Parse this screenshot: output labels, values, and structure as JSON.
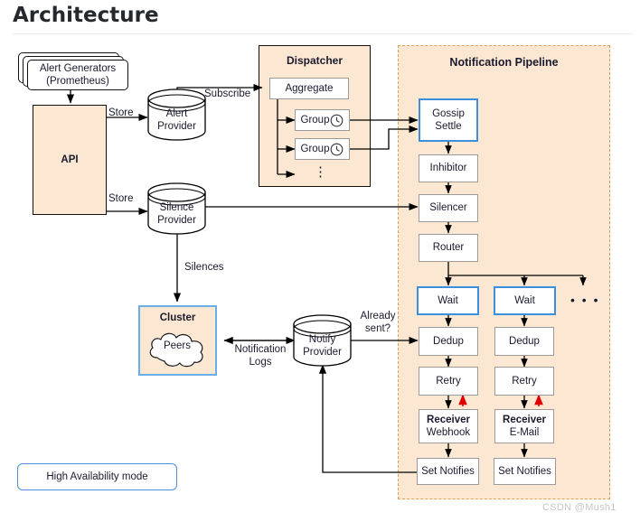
{
  "page": {
    "title": "Architecture",
    "watermark": "CSDN @Mush1"
  },
  "colors": {
    "orange_fill": "#fce8d2",
    "blue_border": "#3c8ede",
    "cluster_border": "#6aaee8",
    "dashed_border": "#d8a25c",
    "red_arrow": "#e00000",
    "gray_border": "#9a9a9a",
    "dark_border": "#101010"
  },
  "nodes": {
    "alert_generators": {
      "line1": "Alert Generators",
      "line2": "(Prometheus)"
    },
    "api": {
      "label": "API"
    },
    "alert_provider": {
      "line1": "Alert",
      "line2": "Provider"
    },
    "silence_provider": {
      "line1": "Silence",
      "line2": "Provider"
    },
    "notify_provider": {
      "line1": "Notify",
      "line2": "Provider"
    },
    "cluster": {
      "title": "Cluster",
      "peers": "Peers"
    },
    "ha_legend": {
      "label": "High Availability mode"
    }
  },
  "dispatcher": {
    "title": "Dispatcher",
    "aggregate": "Aggregate",
    "groups": [
      "Group",
      "Group"
    ],
    "ellipsis": "⋮"
  },
  "pipeline": {
    "title": "Notification Pipeline",
    "stages": {
      "gossip_settle": {
        "line1": "Gossip",
        "line2": "Settle"
      },
      "inhibitor": "Inhibitor",
      "silencer": "Silencer",
      "router": "Router"
    },
    "columns": [
      {
        "wait": "Wait",
        "dedup": "Dedup",
        "retry": "Retry",
        "receiver_title": "Receiver",
        "receiver_kind": "Webhook",
        "set_notifies": "Set Notifies"
      },
      {
        "wait": "Wait",
        "dedup": "Dedup",
        "retry": "Retry",
        "receiver_title": "Receiver",
        "receiver_kind": "E-Mail",
        "set_notifies": "Set Notifies"
      }
    ],
    "more_columns_indicator": "• • •"
  },
  "edges": {
    "store_alert": "Store",
    "store_silence": "Store",
    "subscribe": "Subscribe",
    "silences": "Silences",
    "notification_logs_l1": "Notification",
    "notification_logs_l2": "Logs",
    "already_sent_l1": "Already",
    "already_sent_l2": "sent?"
  }
}
